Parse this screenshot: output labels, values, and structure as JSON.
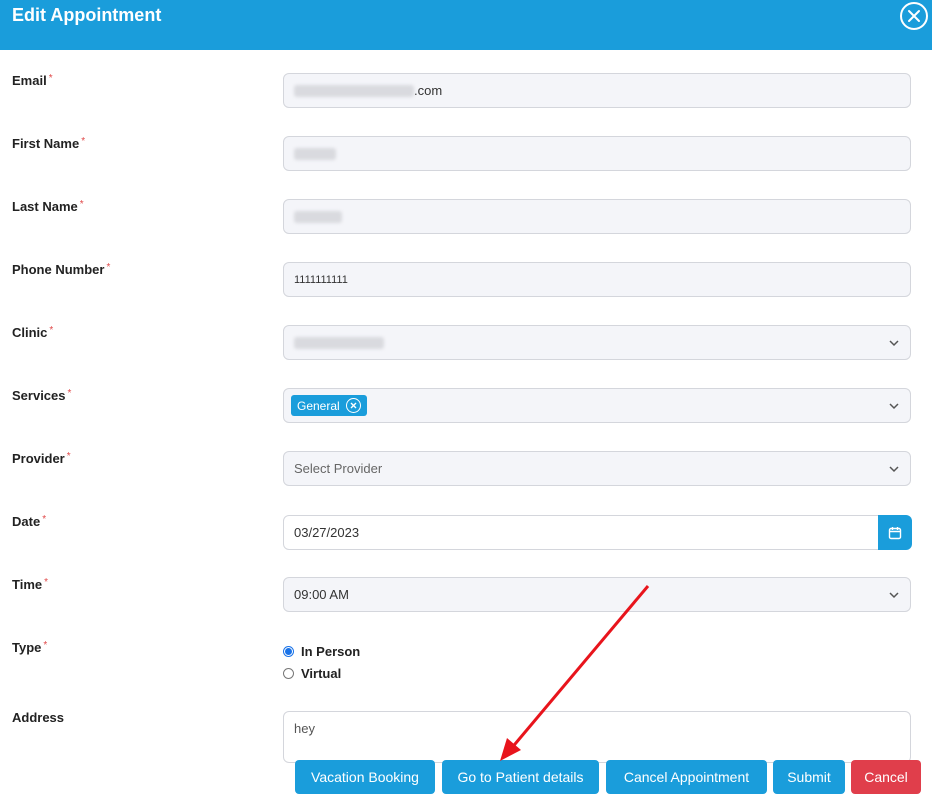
{
  "dialog": {
    "title": "Edit Appointment",
    "close_icon": "close-circle-icon"
  },
  "fields": {
    "email": {
      "label": "Email",
      "required": "*",
      "value_suffix": ".com"
    },
    "first_name": {
      "label": "First Name",
      "required": "*"
    },
    "last_name": {
      "label": "Last Name",
      "required": "*"
    },
    "phone": {
      "label": "Phone Number",
      "required": "*",
      "value": "1111111111"
    },
    "clinic": {
      "label": "Clinic",
      "required": "*"
    },
    "services": {
      "label": "Services",
      "required": "*",
      "selected": [
        "General"
      ]
    },
    "provider": {
      "label": "Provider",
      "required": "*",
      "placeholder": "Select Provider"
    },
    "date": {
      "label": "Date",
      "required": "*",
      "value": "03/27/2023"
    },
    "time": {
      "label": "Time",
      "required": "*",
      "value": "09:00 AM"
    },
    "type": {
      "label": "Type",
      "required": "*",
      "options": [
        {
          "label": "In Person",
          "selected": true
        },
        {
          "label": "Virtual",
          "selected": false
        }
      ]
    },
    "address": {
      "label": "Address",
      "value": "hey"
    }
  },
  "buttons": {
    "vacation": "Vacation Booking",
    "patient_details": "Go to Patient details",
    "cancel_appointment": "Cancel Appointment",
    "submit": "Submit",
    "cancel": "Cancel"
  },
  "colors": {
    "primary": "#1a9ddb",
    "danger": "#e03e4b",
    "annotation_arrow": "#e8141c"
  }
}
